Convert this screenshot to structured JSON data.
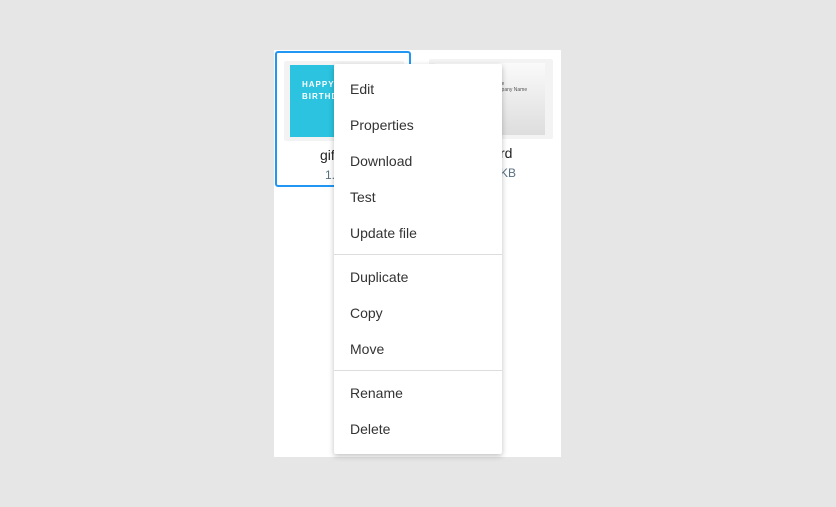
{
  "files": [
    {
      "name": "gif",
      "size": "1.",
      "thumb_text": [
        "HAPPY",
        "BIRTHDAY"
      ],
      "selected": true
    },
    {
      "name": "rd",
      "size": "KB",
      "thumb_text": [
        "Name",
        "Company Name"
      ],
      "selected": false
    }
  ],
  "menu": {
    "groups": [
      [
        "Edit",
        "Properties",
        "Download",
        "Test",
        "Update file"
      ],
      [
        "Duplicate",
        "Copy",
        "Move"
      ],
      [
        "Rename",
        "Delete"
      ]
    ]
  },
  "colors": {
    "selection": "#2196f3",
    "thumbnail": "#2bc3e0"
  }
}
